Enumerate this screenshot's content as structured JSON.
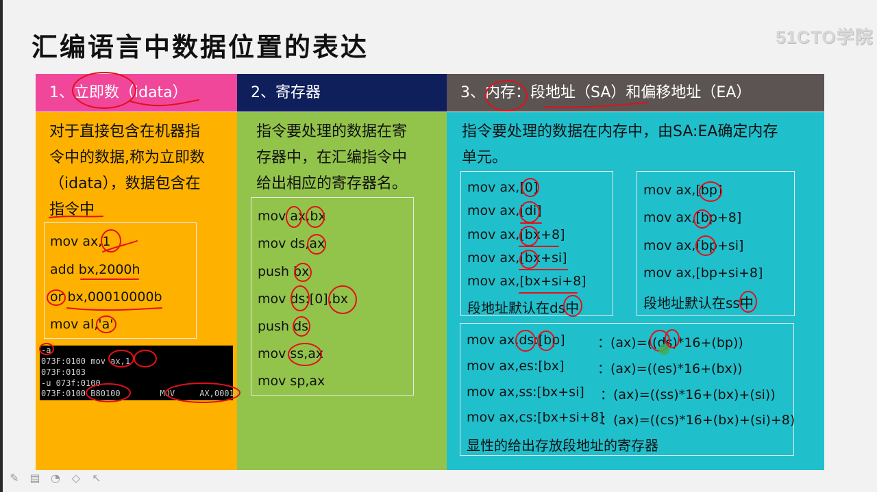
{
  "title": "汇编语言中数据位置的表达",
  "watermark": "51CTO学院",
  "columns": {
    "immediate": {
      "header": "1、立即数（idata）",
      "description": [
        "对于直接包含在机器指",
        "令中的数据,称为立即数",
        "（idata），数据包含在",
        "指令中"
      ],
      "code": [
        "mov ax,1",
        "add bx,2000h",
        "or bx,00010000b",
        "mov al,'a'"
      ],
      "terminal": [
        "-a",
        "073F:0100 mov ax,1",
        "073F:0103",
        "-u 073f:0100",
        "073F:0100 B80100        MOV     AX,0001"
      ]
    },
    "register": {
      "header": "2、寄存器",
      "description": [
        "指令要处理的数据在寄",
        "存器中，在汇编指令中",
        "给出相应的寄存器名。"
      ],
      "code": [
        "mov ax,bx",
        "mov ds,ax",
        "push bx",
        "mov ds:[0],bx",
        "push ds",
        "mov ss,ax",
        "mov sp,ax"
      ]
    },
    "memory": {
      "header": "3、内存：段地址（SA）和偏移地址（EA）",
      "description": [
        "指令要处理的数据在内存中，由SA:EA确定内存",
        "单元。"
      ],
      "box_ds": [
        "mov ax,[0]",
        "mov ax,[di]",
        "mov ax,[bx+8]",
        "mov ax,[bx+si]",
        "mov ax,[bx+si+8]",
        "段地址默认在ds中"
      ],
      "box_ss": [
        "mov ax,[bp]",
        "mov ax,[bp+8]",
        "mov ax,[bp+si]",
        "mov ax,[bp+si+8]",
        "段地址默认在ss中"
      ],
      "explicit": [
        {
          "code": "mov ax,ds:[bp]",
          "expr": "：(ax)=((ds)*16+(bp))"
        },
        {
          "code": "mov ax,es:[bx]",
          "expr": "：(ax)=((es)*16+(bx))"
        },
        {
          "code": "mov ax,ss:[bx+si]",
          "expr": "：(ax)=((ss)*16+(bx)+(si))"
        },
        {
          "code": "mov ax,cs:[bx+si+8]",
          "expr": "：(ax)=((cs)*16+(bx)+(si)+8)"
        }
      ],
      "explicit_note": "显性的给出存放段地址的寄存器"
    }
  },
  "colors": {
    "header1": "#f0479a",
    "header2": "#0f1f5c",
    "header3": "#5b5452",
    "col1": "#ffb100",
    "col2": "#92c34a",
    "col3": "#20bfcc",
    "annotation": "#e3101a"
  },
  "toolbar": [
    "pen-icon",
    "slide-icon",
    "highlighter-icon",
    "eraser-icon",
    "pointer-icon"
  ]
}
